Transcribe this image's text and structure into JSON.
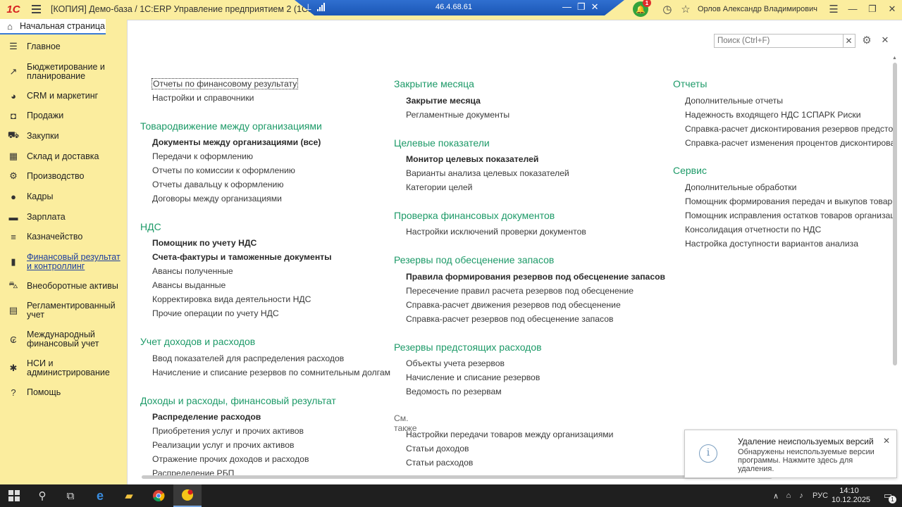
{
  "titlebar": {
    "title": "[КОПИЯ] Демо-база / 1С:ERP Управление предприятием 2  (1С:Предприятие)",
    "rdp_ip": "46.4.68.61",
    "notification_count": "1",
    "user_name": "Орлов Александр Владимирович"
  },
  "home_tab": {
    "label": "Начальная страница"
  },
  "sidebar": {
    "items": [
      {
        "label": "Главное"
      },
      {
        "label": "Бюджетирование и планирование"
      },
      {
        "label": "CRM и маркетинг"
      },
      {
        "label": "Продажи"
      },
      {
        "label": "Закупки"
      },
      {
        "label": "Склад и доставка"
      },
      {
        "label": "Производство"
      },
      {
        "label": "Кадры"
      },
      {
        "label": "Зарплата"
      },
      {
        "label": "Казначейство"
      },
      {
        "label": "Финансовый результат и контроллинг"
      },
      {
        "label": "Внеоборотные активы"
      },
      {
        "label": "Регламентированный учет"
      },
      {
        "label": "Международный финансовый учет"
      },
      {
        "label": "НСИ и администрирование"
      },
      {
        "label": "Помощь"
      }
    ]
  },
  "search": {
    "placeholder": "Поиск (Ctrl+F)"
  },
  "col1": {
    "top_links": [
      "Отчеты по финансовому результату",
      "Настройки и справочники"
    ],
    "sec1": {
      "title": "Товародвижение между организациями",
      "links": [
        "Документы между организациями (все)",
        "Передачи к оформлению",
        "Отчеты по комиссии к оформлению",
        "Отчеты давальцу к оформлению",
        "Договоры между организациями"
      ]
    },
    "sec2": {
      "title": "НДС",
      "links": [
        "Помощник по учету НДС",
        "Счета-фактуры и таможенные документы",
        "Авансы полученные",
        "Авансы выданные",
        "Корректировка вида деятельности НДС",
        "Прочие операции по учету НДС"
      ]
    },
    "sec3": {
      "title": "Учет доходов и расходов",
      "links": [
        "Ввод показателей для распределения расходов",
        "Начисление и списание резервов по сомнительным долгам"
      ]
    },
    "sec4": {
      "title": "Доходы и расходы, финансовый результат",
      "links": [
        "Распределение расходов",
        "Приобретения услуг и прочих активов",
        "Реализации услуг и прочих активов",
        "Отражение прочих доходов и расходов",
        "Распределение РБП"
      ]
    }
  },
  "col2": {
    "sec1": {
      "title": "Закрытие месяца",
      "links": [
        "Закрытие месяца",
        "Регламентные документы"
      ]
    },
    "sec2": {
      "title": "Целевые показатели",
      "links": [
        "Монитор целевых показателей",
        "Варианты анализа целевых показателей",
        "Категории целей"
      ]
    },
    "sec3": {
      "title": "Проверка финансовых документов",
      "links": [
        "Настройки исключений проверки документов"
      ]
    },
    "sec4": {
      "title": "Резервы под обесценение запасов",
      "links": [
        "Правила формирования резервов под обесценение запасов",
        "Пересечение правил расчета резервов под обесценение",
        "Справка-расчет движения резервов под обесценение",
        "Справка-расчет резервов под обесценение запасов"
      ]
    },
    "sec5": {
      "title": "Резервы предстоящих расходов",
      "links": [
        "Объекты учета резервов",
        "Начисление и списание резервов",
        "Ведомость по резервам"
      ]
    },
    "see_also": {
      "title": "См. также",
      "links": [
        "Настройки передачи товаров между организациями",
        "Статьи доходов",
        "Статьи расходов"
      ]
    }
  },
  "col3": {
    "sec1": {
      "title": "Отчеты",
      "links": [
        "Дополнительные отчеты",
        "Надежность входящего НДС 1СПАРК Риски",
        "Справка-расчет дисконтирования резервов предстоящих",
        "Справка-расчет изменения процентов дисконтирования р"
      ]
    },
    "sec2": {
      "title": "Сервис",
      "links": [
        "Дополнительные обработки",
        "Помощник формирования передач и выкупов товаров",
        "Помощник исправления остатков товаров организаций",
        "Консолидация отчетности по НДС",
        "Настройка доступности вариантов анализа"
      ]
    }
  },
  "popup": {
    "title": "Удаление неиспользуемых версий",
    "text": "Обнаружены неиспользуемые версии программы. Нажмите здесь для удаления."
  },
  "taskbar": {
    "lang": "РУС",
    "time": "14:10",
    "date": "10.12.2025",
    "notification_count": "1"
  }
}
